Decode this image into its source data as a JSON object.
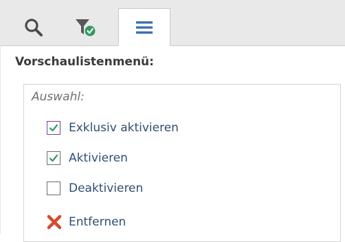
{
  "tabs": [
    {
      "name": "search",
      "icon": "search-icon"
    },
    {
      "name": "filter",
      "icon": "filter-check-icon"
    },
    {
      "name": "menu",
      "icon": "hamburger-menu-icon",
      "active": true
    }
  ],
  "panel": {
    "title": "Vorschaulistenmenü:",
    "group_label": "Auswahl:",
    "items": [
      {
        "label": "Exklusiv aktivieren",
        "state": "checked",
        "icon": "checkbox-icon"
      },
      {
        "label": "Aktivieren",
        "state": "checked",
        "icon": "checkbox-icon"
      },
      {
        "label": "Deaktivieren",
        "state": "unchecked",
        "icon": "checkbox-icon"
      },
      {
        "label": "Entfernen",
        "icon": "remove-x-icon"
      }
    ]
  },
  "colors": {
    "check_green": "#2e9a5f",
    "remove_red": "#d9472a",
    "label_blue": "#2f4e78",
    "menu_icon_blue": "#3b6fb3"
  }
}
